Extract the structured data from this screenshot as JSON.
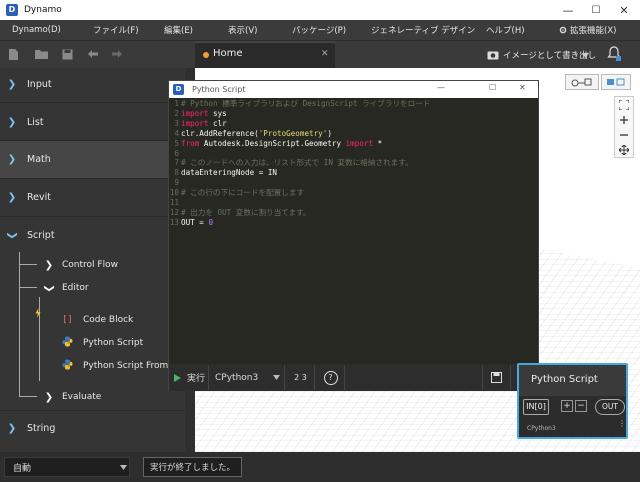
{
  "window": {
    "title": "Dynamo",
    "app_icon": "D",
    "min": "—",
    "max": "☐",
    "close": "✕"
  },
  "menu": {
    "items": [
      "Dynamo(D)",
      "ファイル(F)",
      "編集(E)",
      "表示(V)",
      "パッケージ(P)",
      "ジェネレーティブ デザイン",
      "ヘルプ(H)",
      "拡張機能(X)"
    ]
  },
  "toolbar": {
    "tab_label": "Home",
    "tab_close": "✕",
    "export_label": "イメージとして書き出し"
  },
  "sidebar": {
    "items": [
      "Input",
      "List",
      "Math",
      "Revit",
      "Script",
      "String"
    ],
    "sub": {
      "control_flow": "Control Flow",
      "editor": "Editor",
      "evaluate": "Evaluate"
    },
    "leaves": [
      "Code Block",
      "Python Script",
      "Python Script From"
    ]
  },
  "python": {
    "title": "Python Script",
    "lines": [
      "# Python 標準ライブラリおよび DesignScript ライブラリをロード",
      "import sys",
      "import clr",
      "clr.AddReference('ProtoGeometry')",
      "from Autodesk.DesignScript.Geometry import *",
      "",
      "# このノードへの入力は、リスト形式で IN 変数に格納されます。",
      "dataEnteringNode = IN",
      "",
      "# この行の下にコードを配置します",
      "",
      "# 出力を OUT 変数に割り当てます。",
      "OUT = 0"
    ],
    "run_label": "実行",
    "engine": "CPython3",
    "convert_label": "2 3",
    "help_label": "?"
  },
  "node": {
    "title": "Python Script",
    "in_port": "IN[0]",
    "plus": "+",
    "minus": "−",
    "out_port": "OUT",
    "engine": "CPython3"
  },
  "status": {
    "mode": "自動",
    "message": "実行が終了しました。"
  },
  "colors": {
    "accent": "#7ec8f5",
    "node_border": "#47a8e0"
  }
}
